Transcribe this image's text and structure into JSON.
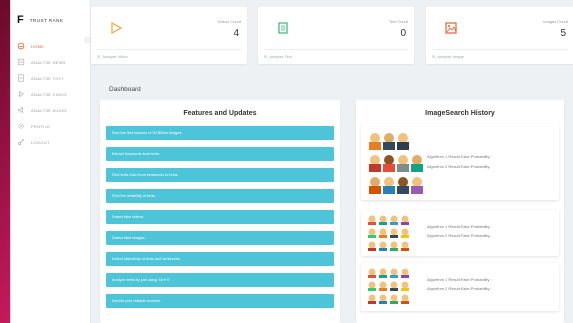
{
  "brand": {
    "mark": "F",
    "name": "TRUST RANK"
  },
  "nav": [
    {
      "label": "HOME",
      "icon": "home-icon",
      "active": true
    },
    {
      "label": "ANALYSE NEWS",
      "icon": "newspaper-icon",
      "active": false
    },
    {
      "label": "ANALYSE TEXT",
      "icon": "document-icon",
      "active": false
    },
    {
      "label": "ANALYSE VIDEO",
      "icon": "video-icon",
      "active": false
    },
    {
      "label": "ANALYSE AUDIO",
      "icon": "audio-icon",
      "active": false
    },
    {
      "label": "PROFILE",
      "icon": "gear-icon",
      "active": false
    },
    {
      "label": "LOGOUT",
      "icon": "logout-icon",
      "active": false
    }
  ],
  "stats": [
    {
      "label": "Videos Count",
      "value": "4",
      "footer": "Analyse Video",
      "color": "#f2a33a"
    },
    {
      "label": "Text Count",
      "value": "0",
      "footer": "Analyse Text",
      "color": "#3bb27a"
    },
    {
      "label": "Images Count",
      "value": "5",
      "footer": "Analyse Image",
      "color": "#e8602c"
    }
  ],
  "dashboard_title": "Dashboard",
  "features": {
    "title": "Features and Updates",
    "items": [
      "Find the first sources of 50 Billion Images.",
      "Extract Keywords from texts.",
      "Find texts from from sentences to texts.",
      "Find the reliability of texts.",
      "Detect fake videos.",
      "Detect fake images.",
      "Detect objectivity of texts and sentences.",
      "Analyze texts by just using ‘Ctrl+V’",
      "Decide your reliable sources."
    ]
  },
  "history": {
    "title": "ImageSearch History",
    "rows": [
      {
        "l1": "Algorithm 1 Result:Fake Probability:",
        "l2": "Algorithm 2 Result:Fake Probability:"
      },
      {
        "l1": "Algorithm 1 Result:Fake Probability:",
        "l2": "Algorithm 2 Result:Fake Probability:"
      },
      {
        "l1": "Algorithm 1 Result:Fake Probability:",
        "l2": "Algorithm 2 Result:Fake Probability:"
      }
    ]
  },
  "colors": {
    "accent": "#e8602c",
    "feature_bar": "#4dc4d8"
  }
}
